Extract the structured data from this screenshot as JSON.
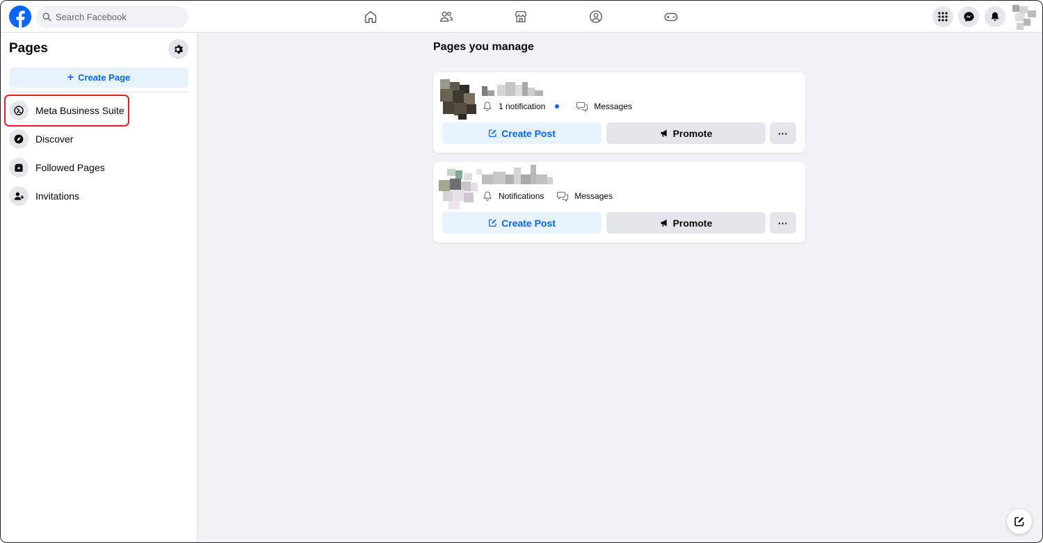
{
  "search": {
    "placeholder": "Search Facebook"
  },
  "nav": [
    "home-icon",
    "friends-icon",
    "marketplace-icon",
    "groups-icon",
    "gaming-icon"
  ],
  "top_right": [
    "menu-grid-icon",
    "messenger-icon",
    "notifications-bell-icon",
    "account-avatar"
  ],
  "sidebar": {
    "title": "Pages",
    "create_label": "Create Page",
    "items": [
      {
        "label": "Meta Business Suite",
        "icon": "meta-business-suite-icon"
      },
      {
        "label": "Discover",
        "icon": "discover-icon"
      },
      {
        "label": "Followed Pages",
        "icon": "followed-pages-icon"
      },
      {
        "label": "Invitations",
        "icon": "invitations-icon"
      }
    ]
  },
  "main": {
    "title": "Pages you manage",
    "cards": [
      {
        "notification": "1 notification",
        "messages": "Messages",
        "create_post": "Create Post",
        "promote": "Promote",
        "more": "···"
      },
      {
        "notification": "Notifications",
        "messages": "Messages",
        "create_post": "Create Post",
        "promote": "Promote",
        "more": "···"
      }
    ]
  },
  "colors": {
    "brand": "#0866ff",
    "highlight": "#e41e26",
    "background": "#f0f2f5"
  }
}
